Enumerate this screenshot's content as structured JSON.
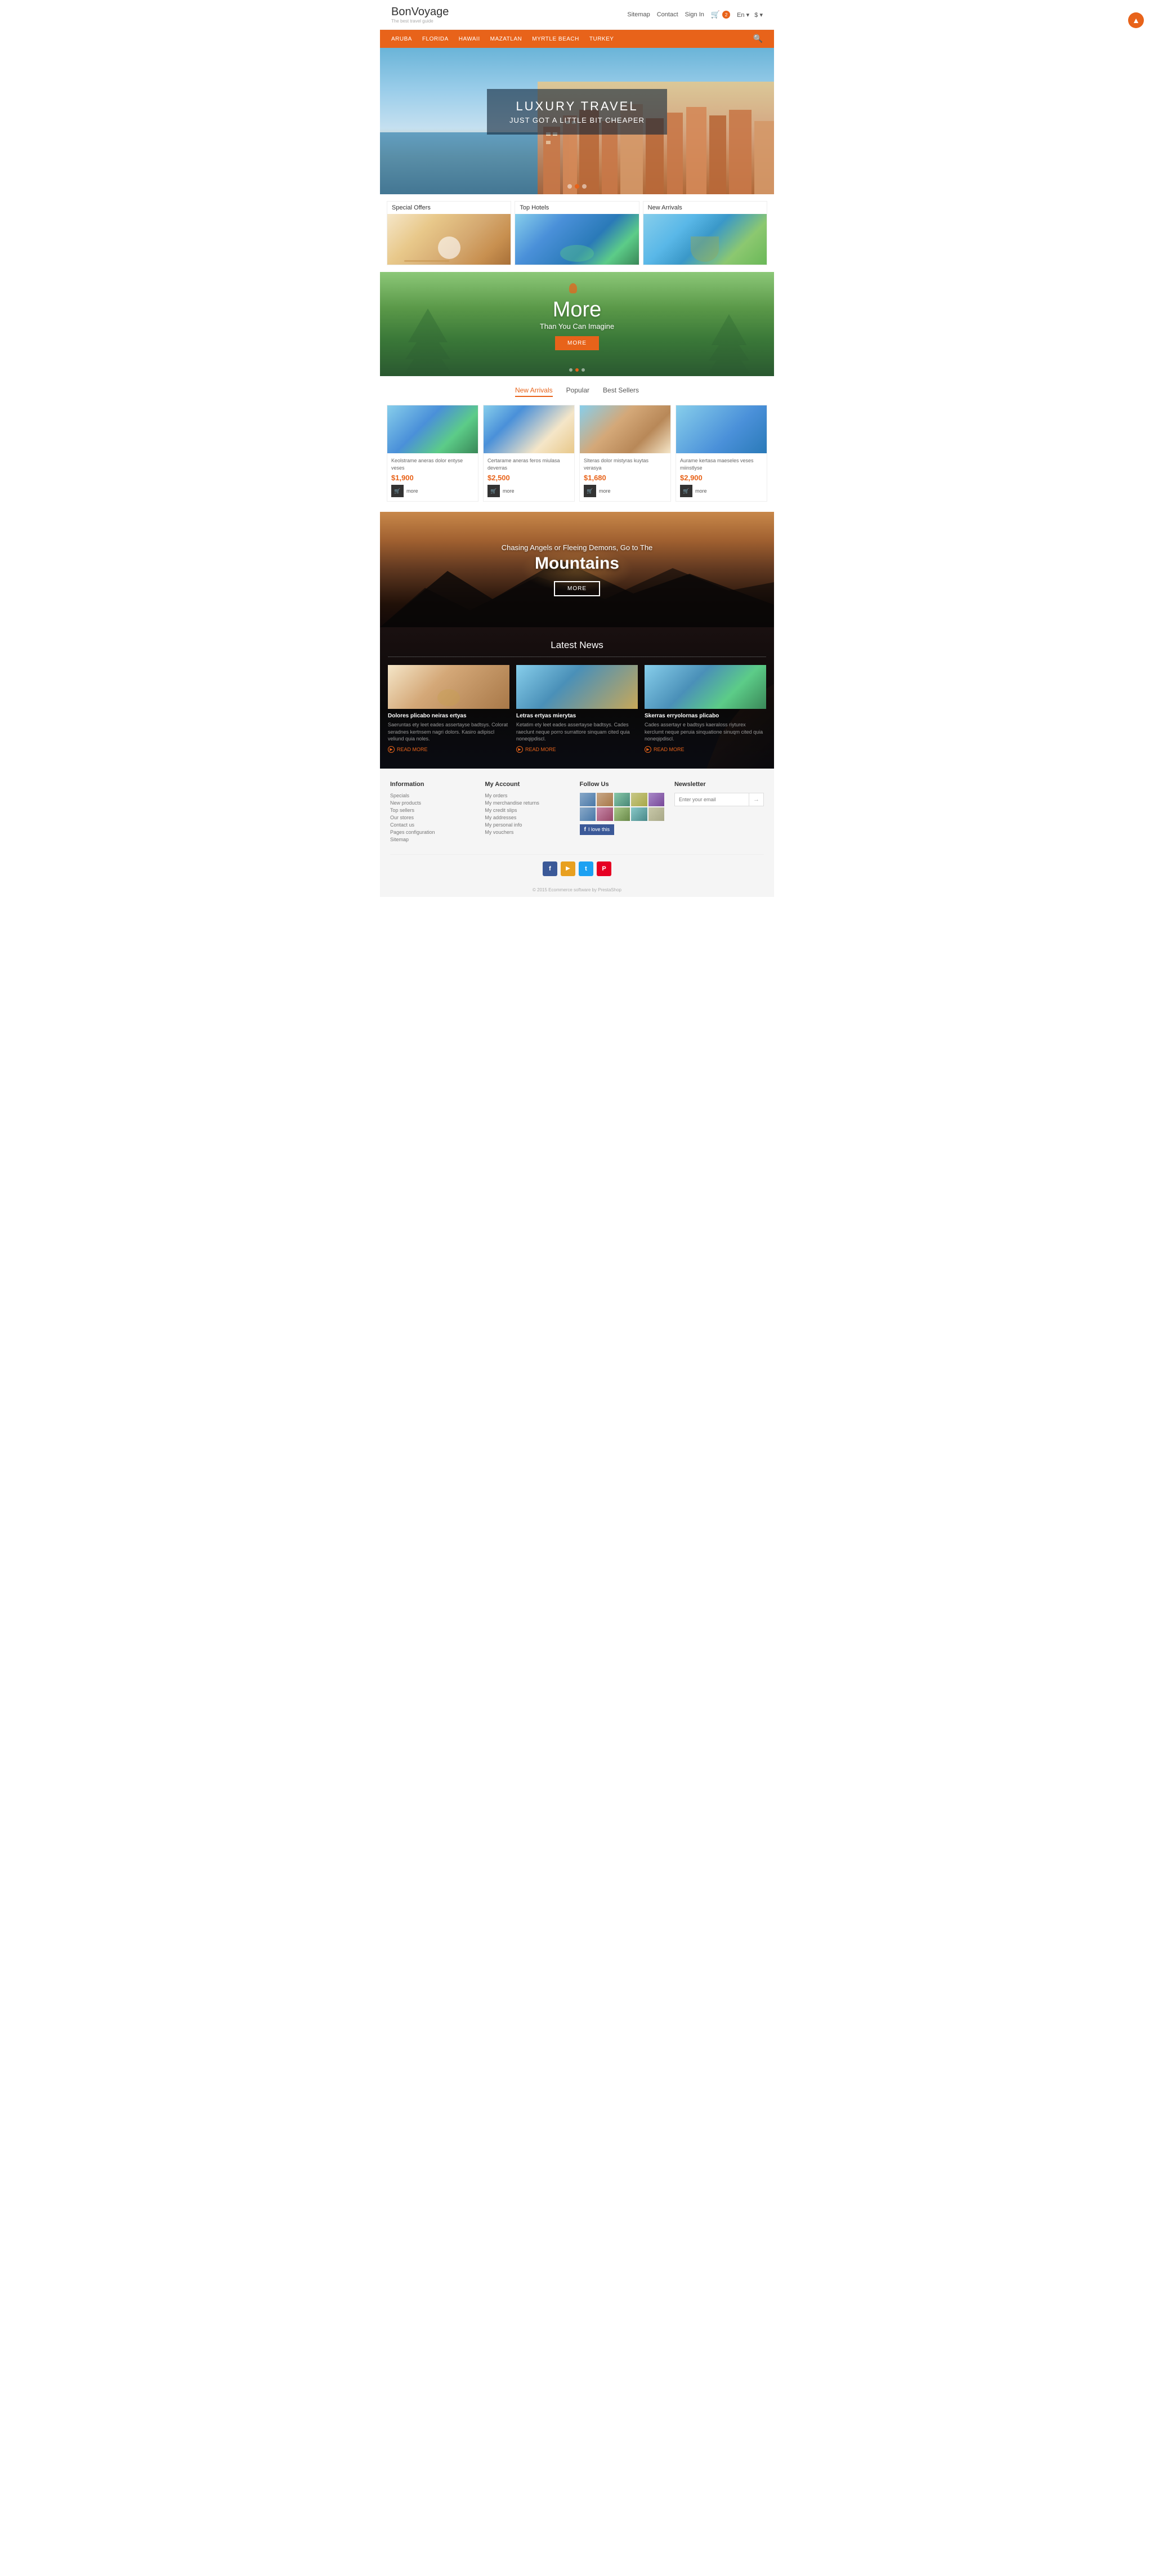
{
  "header": {
    "logo_name": "BonVoyage",
    "logo_bold": "Voyage",
    "logo_sub": "The best travel guide",
    "nav_sitemap": "Sitemap",
    "nav_contact": "Contact",
    "nav_signin": "Sign In",
    "cart_count": "2",
    "lang": "En",
    "currency": "$"
  },
  "navbar": {
    "items": [
      "ARUBA",
      "FLORIDA",
      "HAWAII",
      "MAZATLAN",
      "MYRTLE BEACH",
      "TURKEY"
    ]
  },
  "hero": {
    "line1": "LUXURY TRAVEL",
    "line2": "JUST GOT A LITTLE BIT CHEAPER"
  },
  "categories": [
    {
      "label": "Special Offers",
      "img_class": "cat-image-beach"
    },
    {
      "label": "Top Hotels",
      "img_class": "cat-image-pool"
    },
    {
      "label": "New Arrivals",
      "img_class": "cat-image-coconut"
    }
  ],
  "banner_more": {
    "heading": "More",
    "subheading": "Than You Can Imagine",
    "btn_label": "MORE"
  },
  "products": {
    "tabs": [
      "New Arrivals",
      "Popular",
      "Best Sellers"
    ],
    "active_tab": 0,
    "items": [
      {
        "desc": "Keolstrame aneras dolor entyse veses",
        "price": "$1,900",
        "img_class": "product-img-1"
      },
      {
        "desc": "Certarame aneras feros miulasa deverras",
        "price": "$2,500",
        "img_class": "product-img-2"
      },
      {
        "desc": "Slteras dolor mistyras kuytas verasya",
        "price": "$1,680",
        "img_class": "product-img-3"
      },
      {
        "desc": "Aurame kertasa maeseles veses miinstlyse",
        "price": "$2,900",
        "img_class": "product-img-4"
      }
    ],
    "btn_more": "more"
  },
  "mountains_banner": {
    "line1": "Chasing Angels or Fleeing Demons, Go to The",
    "heading": "Mountains",
    "btn_label": "MORE"
  },
  "news": {
    "section_title": "Latest News",
    "items": [
      {
        "title": "Dolores plicabo neiras ertyas",
        "text": "Saeruntas ety leet eades assertayse badtsys. Colorat seradnes kertnsem nagri dolors. Kasiro adipiscl veliund quia noles.",
        "read_more": "READ MORE",
        "img_class": "news-img-1"
      },
      {
        "title": "Letras ertyas mierytas",
        "text": "Ketatim ety leet eades assertayse badtsys. Cades raeclunt neque porro surrattore sinquam cited quia noneqipdiscl.",
        "read_more": "READ MORE",
        "img_class": "news-img-2"
      },
      {
        "title": "Skerras erryolornas plicabo",
        "text": "Cades assertayr e badtsys kaeraloss riyturex kerclumt neque peruia sinquatione sinuqm cited quia noneqipdiscl.",
        "read_more": "READ MORE",
        "img_class": "news-img-3"
      }
    ]
  },
  "footer": {
    "information": {
      "heading": "Information",
      "links": [
        "Specials",
        "New products",
        "Top sellers",
        "Our stores",
        "Contact us",
        "Pages configuration",
        "Sitemap"
      ]
    },
    "my_account": {
      "heading": "My Account",
      "links": [
        "My orders",
        "My merchandise returns",
        "My credit slips",
        "My addresses",
        "My personal info",
        "My vouchers"
      ]
    },
    "follow_us": {
      "heading": "Follow Us"
    },
    "newsletter": {
      "heading": "Newsletter",
      "placeholder": "Enter your email",
      "btn_label": "→"
    },
    "social": [
      {
        "label": "f",
        "class": "social-fb",
        "name": "Facebook"
      },
      {
        "label": "▶",
        "class": "social-yt",
        "name": "YouTube"
      },
      {
        "label": "t",
        "class": "social-tw",
        "name": "Twitter"
      },
      {
        "label": "P",
        "class": "social-pi",
        "name": "Pinterest"
      }
    ],
    "copyright": "© 2015 Ecommerce software by PrestaShop"
  }
}
